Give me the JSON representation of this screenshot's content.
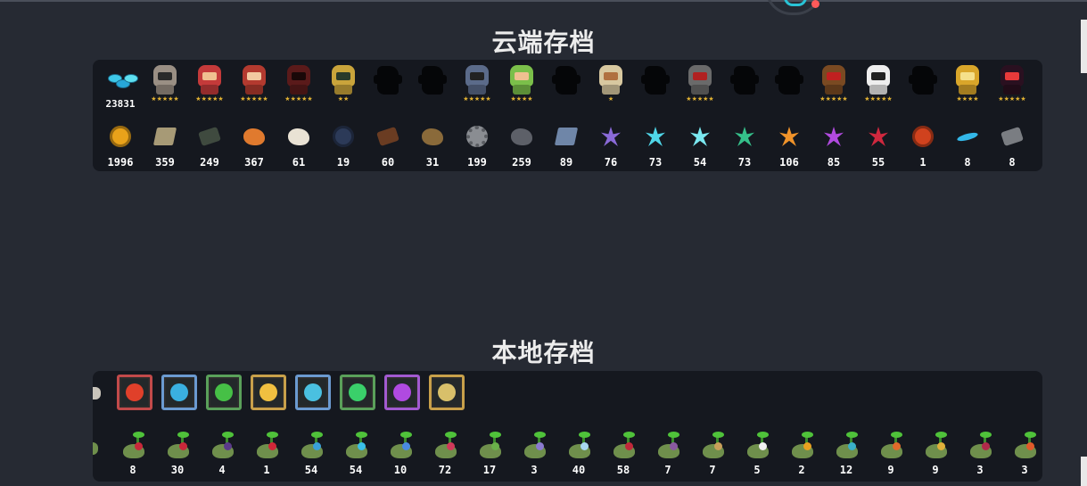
{
  "cloud": {
    "title": "云端存档",
    "heroes": [
      {
        "name": "gem-currency-icon",
        "value": "23831",
        "stars": ""
      },
      {
        "name": "knight-hero-icon",
        "color": "#9a8f84",
        "face": "#2a2a2a",
        "stars": "★★★★★"
      },
      {
        "name": "rogue-hero-icon",
        "color": "#c43a3a",
        "face": "#f0c090",
        "stars": "★★★★★"
      },
      {
        "name": "witch-hero-icon",
        "color": "#b33a2f",
        "face": "#f2c8a0",
        "stars": "★★★★★"
      },
      {
        "name": "assassin-hero-icon",
        "color": "#5a1a1a",
        "face": "#1a0808",
        "stars": "★★★★★"
      },
      {
        "name": "robot-hero-icon",
        "color": "#c9a43b",
        "face": "#2a3a2a",
        "stars": "★★"
      },
      {
        "name": "locked-hero-icon",
        "locked": true,
        "stars": ""
      },
      {
        "name": "locked-hero-icon",
        "locked": true,
        "stars": ""
      },
      {
        "name": "paladin-hero-icon",
        "color": "#5b6b8a",
        "face": "#222",
        "stars": "★★★★★"
      },
      {
        "name": "elf-hero-icon",
        "color": "#7bbf4a",
        "face": "#f0c090",
        "stars": "★★★★"
      },
      {
        "name": "locked-hero-icon",
        "locked": true,
        "stars": ""
      },
      {
        "name": "priest-hero-icon",
        "color": "#d8c8a0",
        "face": "#b07040",
        "stars": "★"
      },
      {
        "name": "locked-hero-icon",
        "locked": true,
        "stars": ""
      },
      {
        "name": "engineer-hero-icon",
        "color": "#6a6a6a",
        "face": "#b02020",
        "stars": "★★★★★"
      },
      {
        "name": "locked-hero-icon",
        "locked": true,
        "stars": ""
      },
      {
        "name": "locked-hero-icon",
        "locked": true,
        "stars": ""
      },
      {
        "name": "berserker-hero-icon",
        "color": "#7a4a22",
        "face": "#c02020",
        "stars": "★★★★★"
      },
      {
        "name": "taoist-hero-icon",
        "color": "#eeeeee",
        "face": "#222",
        "stars": "★★★★★"
      },
      {
        "name": "locked-hero-icon",
        "locked": true,
        "stars": ""
      },
      {
        "name": "golden-mech-hero-icon",
        "color": "#d9a62a",
        "face": "#f5e08a",
        "stars": "★★★★"
      },
      {
        "name": "demon-hero-icon",
        "color": "#2a1020",
        "face": "#e83a3a",
        "stars": "★★★★★"
      }
    ],
    "materials": [
      {
        "name": "gold-coin-icon",
        "value": "1996",
        "color": "#e9a21a",
        "kind": "coin"
      },
      {
        "name": "parchment-icon",
        "value": "359",
        "color": "#a79a76",
        "kind": "sheet"
      },
      {
        "name": "battery-icon",
        "value": "249",
        "color": "#3f4a3f",
        "kind": "block"
      },
      {
        "name": "fish-icon",
        "value": "367",
        "color": "#e07a2e",
        "kind": "blob"
      },
      {
        "name": "flour-sack-icon",
        "value": "61",
        "color": "#e9e2d4",
        "kind": "blob"
      },
      {
        "name": "feather-orb-icon",
        "value": "19",
        "color": "#2c3a58",
        "kind": "coin"
      },
      {
        "name": "boot-icon",
        "value": "60",
        "color": "#6a3c22",
        "kind": "block"
      },
      {
        "name": "horn-icon",
        "value": "31",
        "color": "#8a6a3a",
        "kind": "blob"
      },
      {
        "name": "gear-icon",
        "value": "199",
        "color": "#8a8d92",
        "kind": "gear"
      },
      {
        "name": "ore-icon",
        "value": "259",
        "color": "#5d6068",
        "kind": "blob"
      },
      {
        "name": "cloth-icon",
        "value": "89",
        "color": "#6f86a8",
        "kind": "sheet"
      },
      {
        "name": "purple-crystal-icon",
        "value": "76",
        "color": "#8a6ad8",
        "kind": "gem"
      },
      {
        "name": "cyan-crystal-icon",
        "value": "73",
        "color": "#4fd6e8",
        "kind": "gem"
      },
      {
        "name": "ice-crystal-icon",
        "value": "54",
        "color": "#7ae8f0",
        "kind": "gem"
      },
      {
        "name": "green-crystal-icon",
        "value": "73",
        "color": "#35c08a",
        "kind": "gem"
      },
      {
        "name": "orange-crystal-icon",
        "value": "106",
        "color": "#f0932a",
        "kind": "gem"
      },
      {
        "name": "violet-crystal-icon",
        "value": "85",
        "color": "#b14ae0",
        "kind": "gem"
      },
      {
        "name": "red-crystal-icon",
        "value": "55",
        "color": "#d0283e",
        "kind": "gem"
      },
      {
        "name": "pumpkin-icon",
        "value": "1",
        "color": "#d0421e",
        "kind": "coin"
      },
      {
        "name": "blue-feather-icon",
        "value": "8",
        "color": "#33b7e8",
        "kind": "feather"
      },
      {
        "name": "metal-plate-icon",
        "value": "8",
        "color": "#7a7d82",
        "kind": "block"
      }
    ]
  },
  "local": {
    "title": "本地存档",
    "frames": [
      {
        "name": "fire-skill-frame-icon",
        "border": "#c24a4a",
        "color": "#e0402a"
      },
      {
        "name": "water-skill-frame-icon",
        "border": "#6b9ad0",
        "color": "#3ab0e0"
      },
      {
        "name": "poison-skill-frame-icon",
        "border": "#5aa05a",
        "color": "#46c046"
      },
      {
        "name": "lightning-skill-frame-icon",
        "border": "#c8a04a",
        "color": "#f0c040"
      },
      {
        "name": "frost-skill-frame-icon",
        "border": "#6b9ad0",
        "color": "#4ac0e0"
      },
      {
        "name": "nature-skill-frame-icon",
        "border": "#5aa05a",
        "color": "#3ad06a"
      },
      {
        "name": "arcane-skill-frame-icon",
        "border": "#a25ad0",
        "color": "#b04ae0"
      },
      {
        "name": "golden-skill-frame-icon",
        "border": "#c8a04a",
        "color": "#d8c06a"
      }
    ],
    "seeds": [
      {
        "value": "8",
        "color": "#c8283a"
      },
      {
        "value": "30",
        "color": "#c8283a"
      },
      {
        "value": "4",
        "color": "#5a3a8a"
      },
      {
        "value": "1",
        "color": "#d02838"
      },
      {
        "value": "54",
        "color": "#3aa0d8"
      },
      {
        "value": "54",
        "color": "#3ac0e8"
      },
      {
        "value": "10",
        "color": "#4a8ae0"
      },
      {
        "value": "72",
        "color": "#d03a5a"
      },
      {
        "value": "17",
        "color": "#6ab04a"
      },
      {
        "value": "3",
        "color": "#8a7ad0"
      },
      {
        "value": "40",
        "color": "#a8d8f0"
      },
      {
        "value": "58",
        "color": "#c0283a"
      },
      {
        "value": "7",
        "color": "#8a5aa0"
      },
      {
        "value": "7",
        "color": "#c8a05a"
      },
      {
        "value": "5",
        "color": "#f0f0f0"
      },
      {
        "value": "2",
        "color": "#e8a020"
      },
      {
        "value": "12",
        "color": "#3ab0c8"
      },
      {
        "value": "9",
        "color": "#e06a2a"
      },
      {
        "value": "9",
        "color": "#e0b03a"
      },
      {
        "value": "3",
        "color": "#b02a4a"
      },
      {
        "value": "3",
        "color": "#e05a2a"
      }
    ]
  }
}
